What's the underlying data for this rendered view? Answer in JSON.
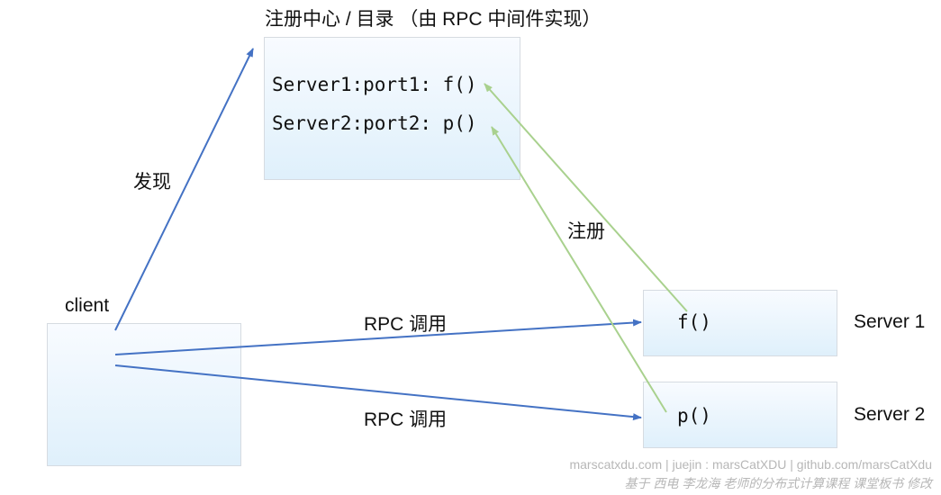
{
  "registry": {
    "title": "注册中心 / 目录 （由 RPC 中间件实现）",
    "entries": [
      "Server1:port1: f()",
      "Server2:port2: p()"
    ]
  },
  "client": {
    "label": "client"
  },
  "servers": [
    {
      "name": "Server 1",
      "function": "f()"
    },
    {
      "name": "Server 2",
      "function": "p()"
    }
  ],
  "edges": {
    "discover": "发现",
    "register": "注册",
    "rpc_call_1": "RPC 调用",
    "rpc_call_2": "RPC 调用"
  },
  "colors": {
    "blue_arrow": "#4472c4",
    "green_arrow": "#a9d18e"
  },
  "watermark": {
    "line1": "marscatxdu.com | juejin : marsCatXDU | github.com/marsCatXdu",
    "line2": "基于 西电 李龙海 老师的分布式计算课程 课堂板书 修改"
  }
}
